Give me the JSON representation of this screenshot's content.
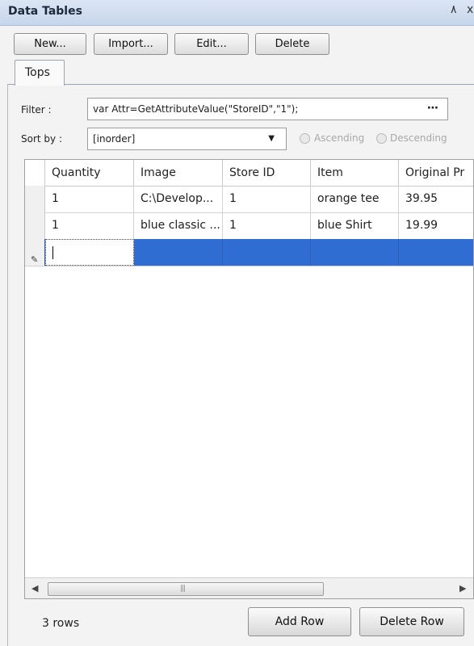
{
  "window": {
    "title": "Data Tables",
    "pin_glyph": "٨",
    "close_glyph": "x"
  },
  "toolbar": {
    "new_label": "New...",
    "import_label": "Import...",
    "edit_label": "Edit...",
    "delete_label": "Delete"
  },
  "tabs": [
    {
      "label": "Tops",
      "active": true
    }
  ],
  "filter": {
    "label": "Filter :",
    "value": "var Attr=GetAttributeValue(\"StoreID\",\"1\");",
    "browse_label": "⋯"
  },
  "sort": {
    "label": "Sort by :",
    "value": "[inorder]",
    "ascending_label": "Ascending",
    "descending_label": "Descending"
  },
  "grid": {
    "columns": [
      "Quantity",
      "Image",
      "Store ID",
      "Item",
      "Original Pr"
    ],
    "rows": [
      [
        "1",
        "C:\\Develop...",
        "1",
        "orange tee",
        "39.95"
      ],
      [
        "1",
        "blue classic ...",
        "1",
        "blue Shirt",
        "19.99"
      ]
    ],
    "new_row_marker": "✎",
    "selection_color": "#2f6dd3"
  },
  "footer": {
    "row_count": "3 rows",
    "add_row_label": "Add Row",
    "delete_row_label": "Delete Row"
  }
}
